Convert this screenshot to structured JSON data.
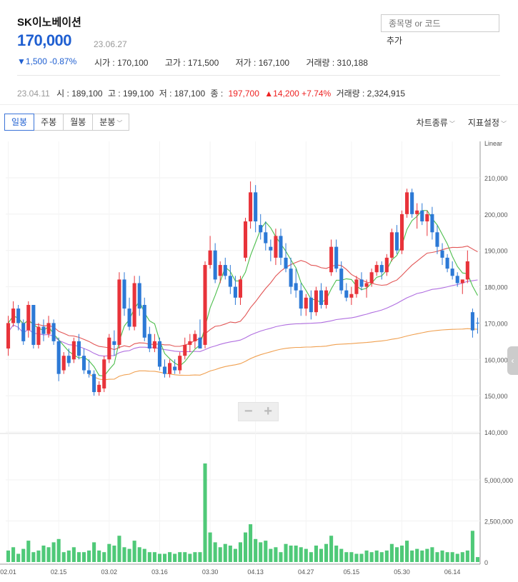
{
  "stock": {
    "name": "SK이노베이션",
    "price": "170,000",
    "date": "23.06.27",
    "change": "▼1,500 -0.87%",
    "open": "시가 : 170,100",
    "high": "고가 : 171,500",
    "low": "저가 : 167,100",
    "volume": "거래량 : 310,188"
  },
  "search": {
    "placeholder": "종목명 or 코드",
    "add_label": "추가"
  },
  "history": {
    "date": "23.04.11",
    "open": "시 : 189,100",
    "high": "고 : 199,100",
    "low": "저 : 187,100",
    "close_label": "종 :",
    "close": "197,700",
    "change": "▲14,200 +7.74%",
    "volume": "거래량 : 2,324,915"
  },
  "tabs": [
    "일봉",
    "주봉",
    "월봉",
    "분봉"
  ],
  "right_tabs": [
    "차트종류",
    "지표설정"
  ],
  "zoom": {
    "minus": "−",
    "plus": "+"
  },
  "colors": {
    "up": "#e8333a",
    "down": "#2c79d6",
    "ma5": "#4cbe4c",
    "ma20": "#e25555",
    "ma60": "#b06ee0",
    "ma120": "#f0a050",
    "volume": "#4fc978"
  },
  "chart_data": {
    "type": "candlestick",
    "scale_label": "Linear",
    "price_axis": {
      "ticks": [
        "210,000",
        "200,000",
        "190,000",
        "180,000",
        "170,000",
        "160,000",
        "150,000",
        "140,000"
      ],
      "min": 140000,
      "max": 210000
    },
    "volume_axis": {
      "ticks": [
        "5,000,000",
        "2,500,000",
        "0"
      ],
      "max": 6500000
    },
    "x_ticks": [
      {
        "index": 0,
        "label": "02.01"
      },
      {
        "index": 10,
        "label": "02.15"
      },
      {
        "index": 20,
        "label": "03.02"
      },
      {
        "index": 30,
        "label": "03.16"
      },
      {
        "index": 40,
        "label": "03.30"
      },
      {
        "index": 49,
        "label": "04.13"
      },
      {
        "index": 59,
        "label": "04.27"
      },
      {
        "index": 68,
        "label": "05.15"
      },
      {
        "index": 78,
        "label": "05.30"
      },
      {
        "index": 88,
        "label": "06.14"
      }
    ],
    "candles": [
      [
        163000,
        172000,
        161000,
        170000
      ],
      [
        170000,
        176000,
        169000,
        174000
      ],
      [
        174000,
        175000,
        168000,
        170000
      ],
      [
        170000,
        171000,
        164000,
        165000
      ],
      [
        168000,
        176000,
        166000,
        175000
      ],
      [
        175000,
        175000,
        163000,
        164000
      ],
      [
        164000,
        170000,
        163000,
        169000
      ],
      [
        169000,
        171000,
        165000,
        167000
      ],
      [
        167000,
        172000,
        166000,
        170000
      ],
      [
        170000,
        171000,
        164000,
        165000
      ],
      [
        165000,
        166000,
        154000,
        156000
      ],
      [
        157000,
        162000,
        156000,
        161000
      ],
      [
        161000,
        163000,
        158000,
        159000
      ],
      [
        160000,
        166000,
        159000,
        165000
      ],
      [
        165000,
        167000,
        160000,
        161000
      ],
      [
        161000,
        163000,
        156000,
        157000
      ],
      [
        157000,
        160000,
        155000,
        156000
      ],
      [
        156000,
        157000,
        150000,
        151000
      ],
      [
        151000,
        154000,
        150000,
        153000
      ],
      [
        152000,
        161000,
        151000,
        160000
      ],
      [
        160000,
        167000,
        159000,
        166000
      ],
      [
        165000,
        168000,
        161000,
        164000
      ],
      [
        164000,
        184000,
        163000,
        182000
      ],
      [
        182000,
        184000,
        172000,
        174000
      ],
      [
        174000,
        177000,
        168000,
        169000
      ],
      [
        169000,
        183000,
        168000,
        181000
      ],
      [
        181000,
        183000,
        172000,
        174000
      ],
      [
        175000,
        177000,
        165000,
        166000
      ],
      [
        167000,
        169000,
        162000,
        163000
      ],
      [
        163000,
        167000,
        162000,
        165000
      ],
      [
        165000,
        166000,
        157000,
        158000
      ],
      [
        158000,
        160000,
        155000,
        156000
      ],
      [
        156000,
        160000,
        155000,
        159000
      ],
      [
        158000,
        160000,
        156000,
        157000
      ],
      [
        157000,
        162000,
        156000,
        161000
      ],
      [
        161000,
        166000,
        160000,
        164000
      ],
      [
        164000,
        167000,
        162000,
        165000
      ],
      [
        165000,
        168000,
        163000,
        167000
      ],
      [
        166000,
        171000,
        164000,
        163000
      ],
      [
        164000,
        187000,
        163000,
        186000
      ],
      [
        186000,
        194000,
        185000,
        190000
      ],
      [
        190000,
        192000,
        181000,
        182000
      ],
      [
        183000,
        187000,
        181000,
        186000
      ],
      [
        186000,
        188000,
        182000,
        183000
      ],
      [
        183000,
        186000,
        178000,
        180000
      ],
      [
        180000,
        183000,
        175000,
        177000
      ],
      [
        177000,
        183000,
        175000,
        182000
      ],
      [
        188000,
        199000,
        187000,
        198000
      ],
      [
        198000,
        209000,
        196000,
        206000
      ],
      [
        206000,
        208000,
        195000,
        198000
      ],
      [
        197000,
        200000,
        193000,
        195000
      ],
      [
        195000,
        198000,
        190000,
        192000
      ],
      [
        191000,
        193000,
        187000,
        190000
      ],
      [
        188000,
        196000,
        186000,
        194000
      ],
      [
        194000,
        196000,
        186000,
        188000
      ],
      [
        188000,
        192000,
        184000,
        185000
      ],
      [
        185000,
        188000,
        178000,
        180000
      ],
      [
        181000,
        185000,
        177000,
        179000
      ],
      [
        179000,
        181000,
        172000,
        174000
      ],
      [
        174000,
        178000,
        172000,
        177000
      ],
      [
        177000,
        179000,
        171000,
        173000
      ],
      [
        173000,
        180000,
        172000,
        179000
      ],
      [
        179000,
        181000,
        174000,
        175000
      ],
      [
        175000,
        180000,
        174000,
        179000
      ],
      [
        184000,
        193000,
        183000,
        191000
      ],
      [
        191000,
        193000,
        184000,
        185000
      ],
      [
        185000,
        187000,
        178000,
        179000
      ],
      [
        179000,
        181000,
        176000,
        177000
      ],
      [
        177000,
        180000,
        175000,
        178000
      ],
      [
        178000,
        183000,
        177000,
        182000
      ],
      [
        182000,
        184000,
        179000,
        180000
      ],
      [
        180000,
        182000,
        177000,
        181000
      ],
      [
        181000,
        185000,
        180000,
        184000
      ],
      [
        184000,
        187000,
        183000,
        186000
      ],
      [
        186000,
        187000,
        182000,
        184000
      ],
      [
        184000,
        189000,
        183000,
        188000
      ],
      [
        188000,
        196000,
        187000,
        195000
      ],
      [
        195000,
        197000,
        189000,
        190000
      ],
      [
        190000,
        201000,
        189000,
        200000
      ],
      [
        200000,
        207000,
        199000,
        206000
      ],
      [
        206000,
        207000,
        199000,
        200000
      ],
      [
        200000,
        203000,
        196000,
        201000
      ],
      [
        201000,
        203000,
        197000,
        198000
      ],
      [
        198000,
        201000,
        194000,
        200000
      ],
      [
        200000,
        202000,
        193000,
        195000
      ],
      [
        195000,
        197000,
        189000,
        191000
      ],
      [
        190000,
        192000,
        186000,
        188000
      ],
      [
        188000,
        189000,
        184000,
        185000
      ],
      [
        185000,
        187000,
        182000,
        183000
      ],
      [
        183000,
        184000,
        180000,
        181000
      ],
      [
        181000,
        182000,
        178000,
        182000
      ],
      [
        182000,
        190000,
        181000,
        187000
      ],
      [
        173000,
        174000,
        166000,
        168000
      ],
      [
        170100,
        171500,
        167100,
        170000
      ]
    ],
    "volume": [
      700000,
      900000,
      500000,
      800000,
      1300000,
      600000,
      700000,
      1000000,
      900000,
      1200000,
      1400000,
      600000,
      700000,
      900000,
      600000,
      600000,
      700000,
      1200000,
      700000,
      600000,
      1100000,
      1000000,
      1600000,
      900000,
      800000,
      1300000,
      900000,
      800000,
      600000,
      600000,
      500000,
      500000,
      600000,
      500000,
      600000,
      600000,
      500000,
      600000,
      600000,
      6000000,
      1800000,
      1200000,
      900000,
      1100000,
      1000000,
      800000,
      1200000,
      1800000,
      2300000,
      1400000,
      1200000,
      1300000,
      800000,
      900000,
      600000,
      1100000,
      1000000,
      1000000,
      900000,
      800000,
      600000,
      1000000,
      800000,
      1100000,
      1600000,
      1000000,
      800000,
      600000,
      600000,
      500000,
      500000,
      700000,
      600000,
      700000,
      600000,
      700000,
      1100000,
      900000,
      1000000,
      1300000,
      700000,
      800000,
      700000,
      800000,
      900000,
      600000,
      700000,
      600000,
      600000,
      500000,
      600000,
      700000,
      1900000,
      300000
    ],
    "ma_series": [
      "MA5",
      "MA20",
      "MA60",
      "MA120"
    ]
  }
}
